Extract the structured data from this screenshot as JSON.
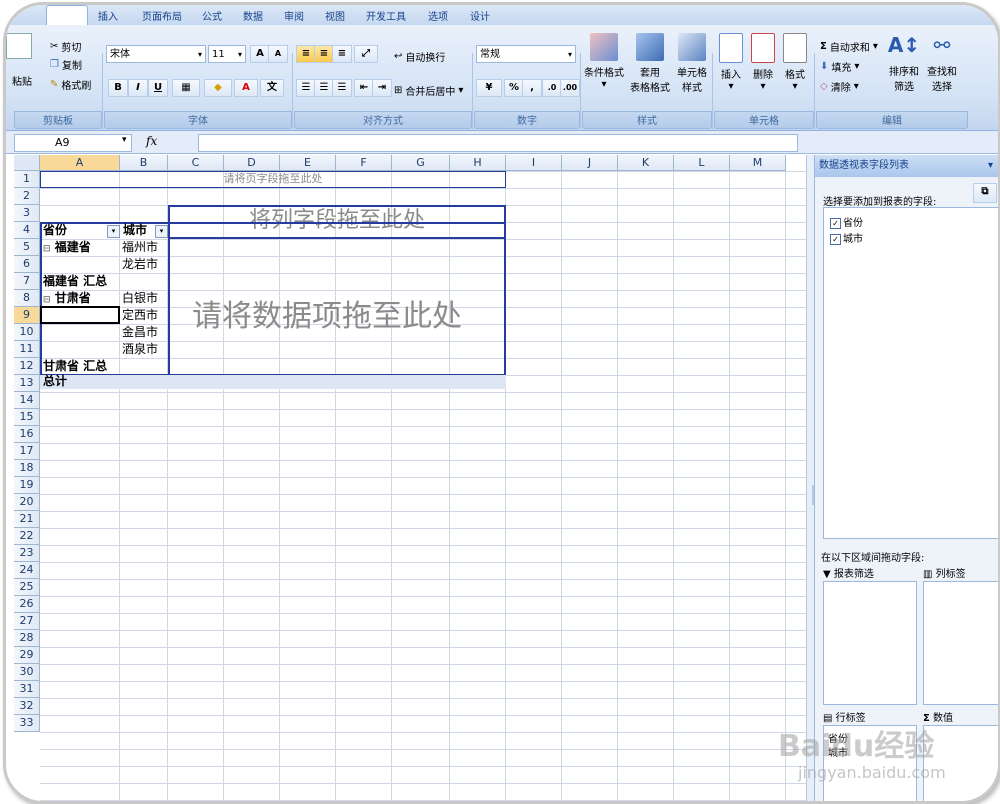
{
  "tabs": [
    "插入",
    "页面布局",
    "公式",
    "数据",
    "审阅",
    "视图",
    "开发工具",
    "选项",
    "设计"
  ],
  "clipboard": {
    "cut": "剪切",
    "copy": "复制",
    "paste": "粘贴",
    "format_painter": "格式刷",
    "group": "剪贴板"
  },
  "font": {
    "name": "宋体",
    "size": "11",
    "grow": "A",
    "shrink": "A",
    "bold": "B",
    "italic": "I",
    "underline": "U",
    "group": "字体"
  },
  "alignment": {
    "wrap": "自动换行",
    "merge": "合并后居中",
    "group": "对齐方式"
  },
  "number": {
    "format": "常规",
    "percent": "%",
    "comma": ",",
    "group": "数字"
  },
  "styles": {
    "conditional": "条件格式",
    "table_l1": "套用",
    "table_l2": "表格格式",
    "cell_l1": "单元格",
    "cell_l2": "样式",
    "group": "样式"
  },
  "cells": {
    "insert": "插入",
    "delete": "删除",
    "format": "格式",
    "group": "单元格"
  },
  "editing": {
    "autosum": "自动求和",
    "fill": "填充",
    "clear": "清除",
    "sort_l1": "排序和",
    "sort_l2": "筛选",
    "find_l1": "查找和",
    "find_l2": "选择",
    "group": "编辑"
  },
  "formula_bar": {
    "name_box": "A9",
    "fx": "fx",
    "formula": ""
  },
  "columns": [
    "A",
    "B",
    "C",
    "D",
    "E",
    "F",
    "G",
    "H",
    "I",
    "J",
    "K",
    "L",
    "M"
  ],
  "rows": [
    "1",
    "2",
    "3",
    "4",
    "5",
    "6",
    "7",
    "8",
    "9",
    "10",
    "11",
    "12",
    "13",
    "14",
    "15",
    "16",
    "17",
    "18",
    "19",
    "20",
    "21",
    "22",
    "23",
    "24",
    "25",
    "26",
    "27",
    "28",
    "29",
    "30",
    "31",
    "32",
    "33"
  ],
  "pivot": {
    "page_drop": "请将页字段拖至此处",
    "col_drop": "将列字段拖至此处",
    "data_drop": "请将数据项拖至此处",
    "header_province": "省份",
    "header_city": "城市",
    "province1": "福建省",
    "p1_cities": [
      "福州市",
      "龙岩市"
    ],
    "p1_total": "福建省 汇总",
    "province2": "甘肃省",
    "p2_cities": [
      "白银市",
      "定西市",
      "金昌市",
      "酒泉市"
    ],
    "p2_total": "甘肃省 汇总",
    "grand_total": "总计"
  },
  "field_pane": {
    "title": "数据透视表字段列表",
    "choose": "选择要添加到报表的字段:",
    "fields": [
      "省份",
      "城市"
    ],
    "drag_label": "在以下区域间拖动字段:",
    "report_filter": "报表筛选",
    "column_labels": "列标签",
    "row_labels": "行标签",
    "values": "数值",
    "row_items": [
      "省份",
      "城市"
    ]
  },
  "watermark": {
    "text": "Baidu经验",
    "url": "jingyan.baidu.com"
  }
}
